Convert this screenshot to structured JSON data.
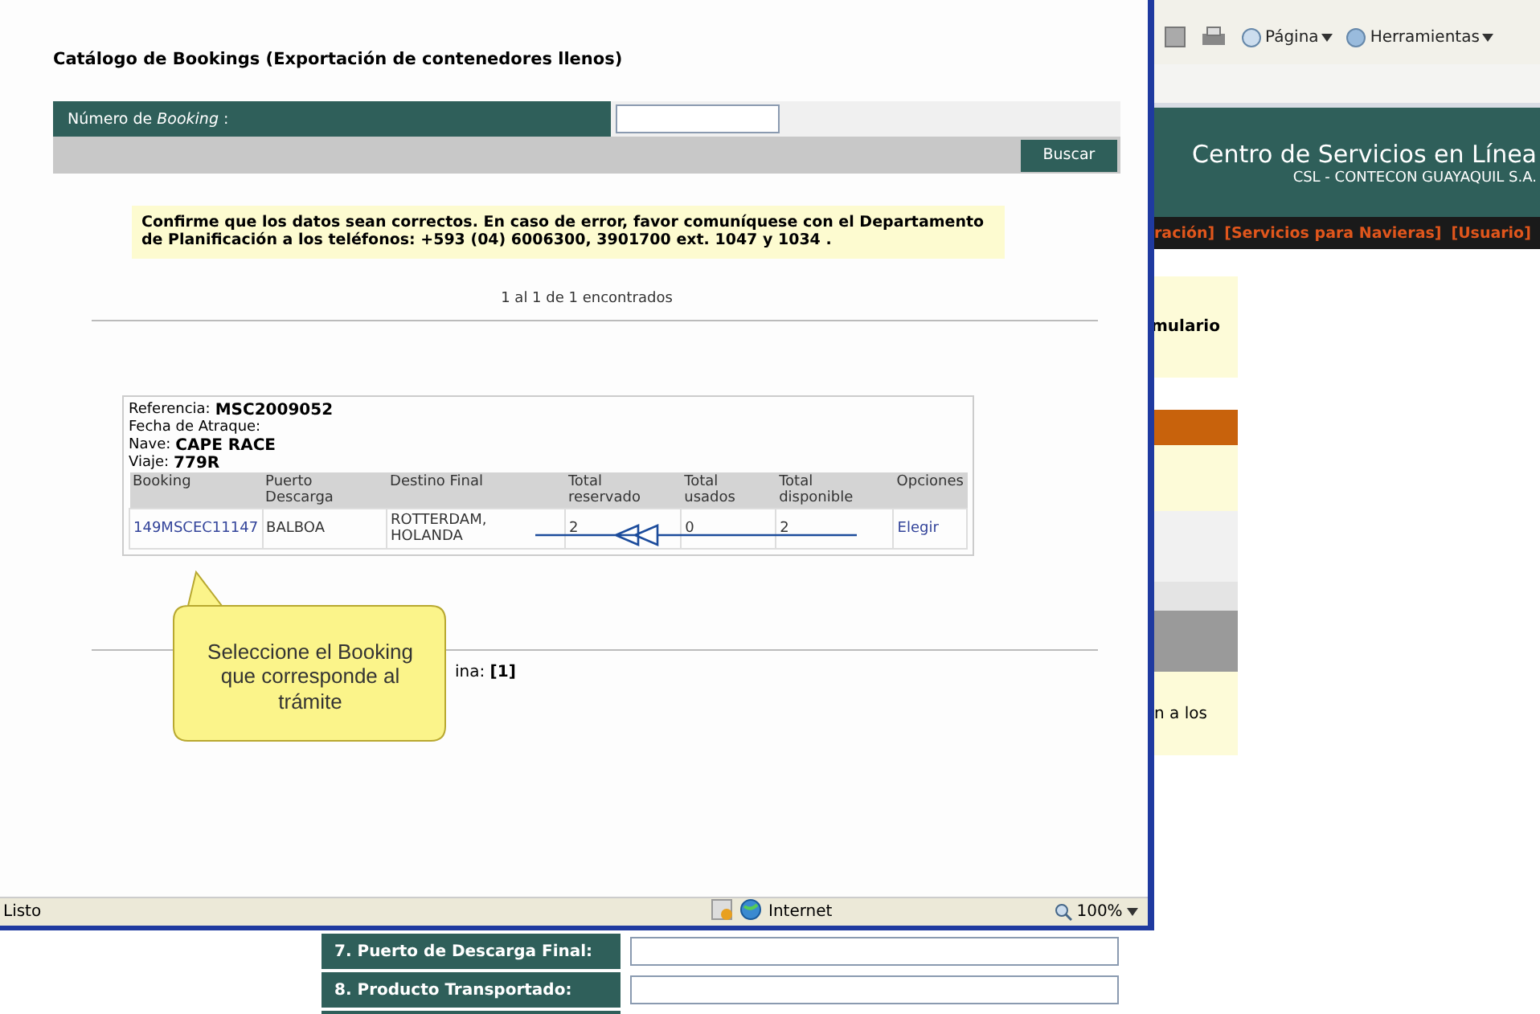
{
  "background": {
    "toolbar": [
      "Página",
      "Herramientas"
    ],
    "header": {
      "title": "Centro de Servicios en Línea",
      "subtitle": "CSL - CONTECON GUAYAQUIL S.A."
    },
    "nav": [
      "ración]",
      "[Servicios para Navieras]",
      "[Usuario]"
    ],
    "fragments": [
      "mulario",
      "n a los"
    ],
    "form_rows": [
      {
        "label": "7. Puerto de Descarga Final:"
      },
      {
        "label": "8. Producto Transportado:"
      }
    ]
  },
  "popup": {
    "title": "Catálogo de Bookings (Exportación de contenedores llenos)",
    "search": {
      "label": "Número de *Booking*:",
      "button": "Buscar"
    },
    "notice": "Confirme que los datos sean correctos. En caso de error, favor comuníquese con el Departamento de Planificación a los teléfonos: +593 (04) 6006300, 3901700 ext. 1047 y 1034 .",
    "result_count": "1 al 1 de 1 encontrados",
    "booking_group": {
      "fields": [
        {
          "label": "Referencia:",
          "value": "MSC2009052"
        },
        {
          "label": "Fecha de Atraque:"
        },
        {
          "label": "Nave:",
          "value": "CAPE RACE"
        },
        {
          "label": "Viaje:",
          "value": "779R"
        }
      ],
      "columns": [
        "Booking",
        "Puerto Descarga",
        "Destino Final",
        "Total reservado",
        "Total usados",
        "Total disponible",
        "Opciones"
      ],
      "rows": [
        {
          "cells": [
            {
              "text": "149MSCEC11147",
              "kind": "link"
            },
            {
              "text": "BALBOA",
              "kind": "text"
            },
            {
              "text": "ROTTERDAM, HOLANDA",
              "kind": "text"
            },
            {
              "text": "2",
              "kind": "text"
            },
            {
              "text": "0",
              "kind": "text"
            },
            {
              "text": "2",
              "kind": "text"
            },
            {
              "text": "Elegir",
              "kind": "link"
            }
          ]
        }
      ]
    },
    "callout": "Seleccione el Booking que corresponde al trámite",
    "pagination": "ina: **[1]**",
    "status_bar": {
      "text": "Listo",
      "zone": "Internet",
      "zoom": "100%"
    }
  }
}
